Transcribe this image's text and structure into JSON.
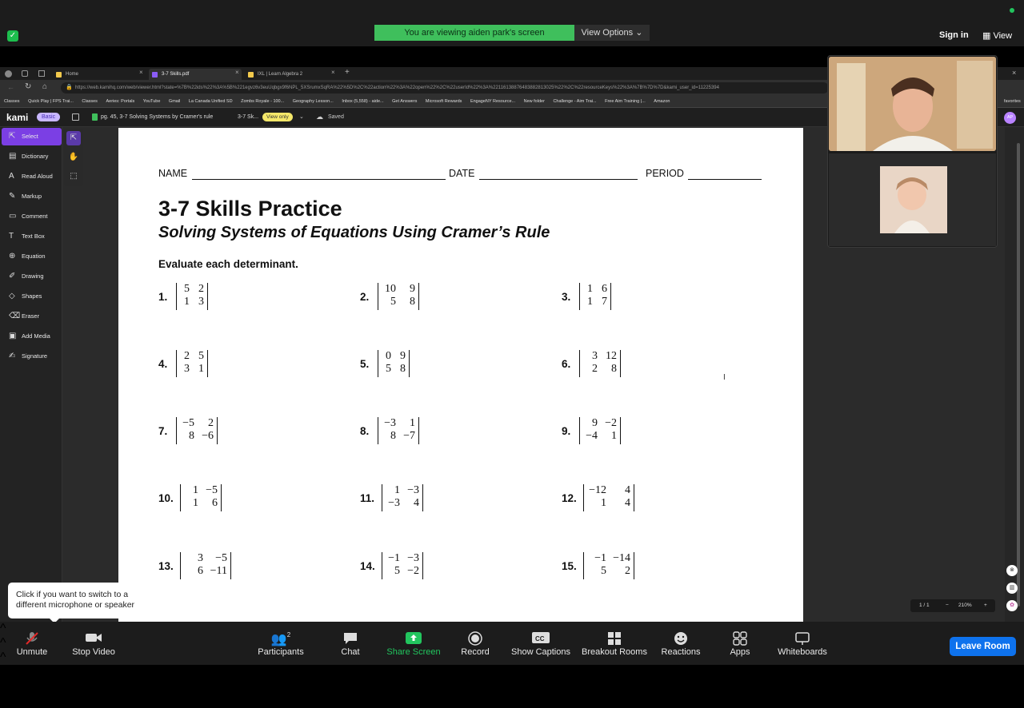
{
  "zoom": {
    "banner": "You are viewing aiden park's screen",
    "view_options": "View Options",
    "sign_in": "Sign in",
    "view": "View"
  },
  "browser": {
    "tabs": [
      {
        "label": "Home",
        "color": "#f2c94c"
      },
      {
        "label": "3-7 Skills.pdf",
        "color": "#8b5cf6"
      },
      {
        "label": "IXL | Learn Algebra 2",
        "color": "#f2c94c"
      }
    ],
    "url": "https://web.kamihq.com/web/viewer.html?state=%7B%22ids%22%3A%5B%221egvz6v3euUqbgx9f6NPL_5XSrumxSqRA%22%5D%2C%22action%22%3A%22open%22%2C%22userId%22%3A%22116138876483882813025%22%2C%22resourceKeys%22%3A%7B%7D%7D&kami_user_id=11225394",
    "bookmarks": [
      "Classes",
      "Quick Play | FPS Trai...",
      "Classes",
      "Aeries: Portals",
      "YouTube",
      "Gmail",
      "La Canada Unified SD",
      "Zombs Royale - 100...",
      "Geography Lesson...",
      "Inbox (5,558) - aide...",
      "Get Answers",
      "Microsoft Rewards",
      "EngageNY Resource...",
      "New folder",
      "Challenge - Aim Trai...",
      "Free Aim Training |...",
      "Amazon",
      "favorites"
    ]
  },
  "kami": {
    "logo": "kami",
    "plan": "Basic",
    "doc_title": "pg. 45, 3-7 Solving Systems by Cramer's rule",
    "tab_name": "3-7 Sk...",
    "view_only": "View only",
    "saved": "Saved",
    "user_initials": "AP",
    "tools": [
      {
        "label": "Select",
        "icon": "cursor-icon"
      },
      {
        "label": "Dictionary",
        "icon": "dictionary-icon"
      },
      {
        "label": "Read Aloud",
        "icon": "read-aloud-icon"
      },
      {
        "label": "Markup",
        "icon": "markup-icon"
      },
      {
        "label": "Comment",
        "icon": "comment-icon"
      },
      {
        "label": "Text Box",
        "icon": "text-box-icon"
      },
      {
        "label": "Equation",
        "icon": "equation-icon"
      },
      {
        "label": "Drawing",
        "icon": "drawing-icon"
      },
      {
        "label": "Shapes",
        "icon": "shapes-icon"
      },
      {
        "label": "Eraser",
        "icon": "eraser-icon"
      },
      {
        "label": "Add Media",
        "icon": "add-media-icon"
      },
      {
        "label": "Signature",
        "icon": "signature-icon"
      }
    ],
    "page_indicator": "1 / 1",
    "zoom_level": "210%"
  },
  "worksheet": {
    "name_label": "NAME",
    "date_label": "DATE",
    "period_label": "PERIOD",
    "title": "3-7 Skills Practice",
    "subtitle": "Solving Systems of Equations Using Cramer’s Rule",
    "instruction": "Evaluate each determinant.",
    "problems": [
      {
        "num": "1.",
        "m": [
          "5",
          "2",
          "1",
          "3"
        ]
      },
      {
        "num": "2.",
        "m": [
          "10",
          "9",
          "5",
          "8"
        ]
      },
      {
        "num": "3.",
        "m": [
          "1",
          "6",
          "1",
          "7"
        ]
      },
      {
        "num": "4.",
        "m": [
          "2",
          "5",
          "3",
          "1"
        ]
      },
      {
        "num": "5.",
        "m": [
          "0",
          "9",
          "5",
          "8"
        ]
      },
      {
        "num": "6.",
        "m": [
          "3",
          "12",
          "2",
          "8"
        ]
      },
      {
        "num": "7.",
        "m": [
          "−5",
          "2",
          "8",
          "−6"
        ]
      },
      {
        "num": "8.",
        "m": [
          "−3",
          "1",
          "8",
          "−7"
        ]
      },
      {
        "num": "9.",
        "m": [
          "9",
          "−2",
          "−4",
          "1"
        ]
      },
      {
        "num": "10.",
        "m": [
          "1",
          "−5",
          "1",
          "6"
        ]
      },
      {
        "num": "11.",
        "m": [
          "1",
          "−3",
          "−3",
          "4"
        ]
      },
      {
        "num": "12.",
        "m": [
          "−12",
          "4",
          "1",
          "4"
        ]
      },
      {
        "num": "13.",
        "m": [
          "3",
          "−5",
          "6",
          "−11"
        ]
      },
      {
        "num": "14.",
        "m": [
          "−1",
          "−3",
          "5",
          "−2"
        ]
      },
      {
        "num": "15.",
        "m": [
          "−1",
          "−14",
          "5",
          "2"
        ]
      }
    ]
  },
  "tooltip": "Click if you want to switch to a different microphone or speaker",
  "toolbar": {
    "unmute": "Unmute",
    "stop_video": "Stop Video",
    "participants": "Participants",
    "participants_count": "2",
    "chat": "Chat",
    "share_screen": "Share Screen",
    "record": "Record",
    "show_captions": "Show Captions",
    "breakout_rooms": "Breakout Rooms",
    "reactions": "Reactions",
    "apps": "Apps",
    "whiteboards": "Whiteboards",
    "leave_room": "Leave Room"
  },
  "colors": {
    "banner_green": "#3fbf5c",
    "kami_purple": "#7b3fe4",
    "share_green": "#22c55e",
    "leave_blue": "#0e72ed"
  }
}
